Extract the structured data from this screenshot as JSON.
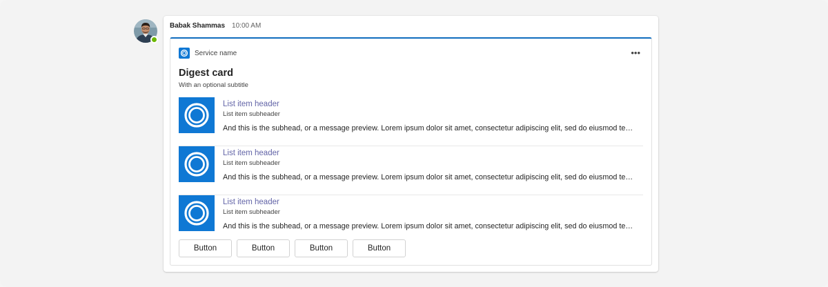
{
  "message": {
    "sender": "Babak Shammas",
    "timestamp": "10:00 AM",
    "presence": "available"
  },
  "card": {
    "service_name": "Service name",
    "more_label": "•••",
    "title": "Digest card",
    "subtitle": "With an optional subtitle",
    "items": [
      {
        "header": "List item header",
        "subheader": "List item subheader",
        "preview": "And this is the subhead, or a message preview. Lorem ipsum dolor sit amet, consectetur adipiscing elit, sed do eiusmod tempor incididunt ut labore",
        "icon": "ring-logo-icon"
      },
      {
        "header": "List item header",
        "subheader": "List item subheader",
        "preview": "And this is the subhead, or a message preview. Lorem ipsum dolor sit amet, consectetur adipiscing elit, sed do eiusmod tempor incididunt ut labore",
        "icon": "ring-logo-icon"
      },
      {
        "header": "List item header",
        "subheader": "List item subheader",
        "preview": "And this is the subhead, or a message preview. Lorem ipsum dolor sit amet, consectetur adipiscing elit, sed do eiusmod tempor incididunt ut labore",
        "icon": "ring-logo-icon"
      }
    ],
    "buttons": [
      "Button",
      "Button",
      "Button",
      "Button"
    ]
  },
  "colors": {
    "accent": "#0f6cbd",
    "brand_tile": "#0f78d4",
    "link": "#6264a7",
    "presence": "#6bb700"
  }
}
